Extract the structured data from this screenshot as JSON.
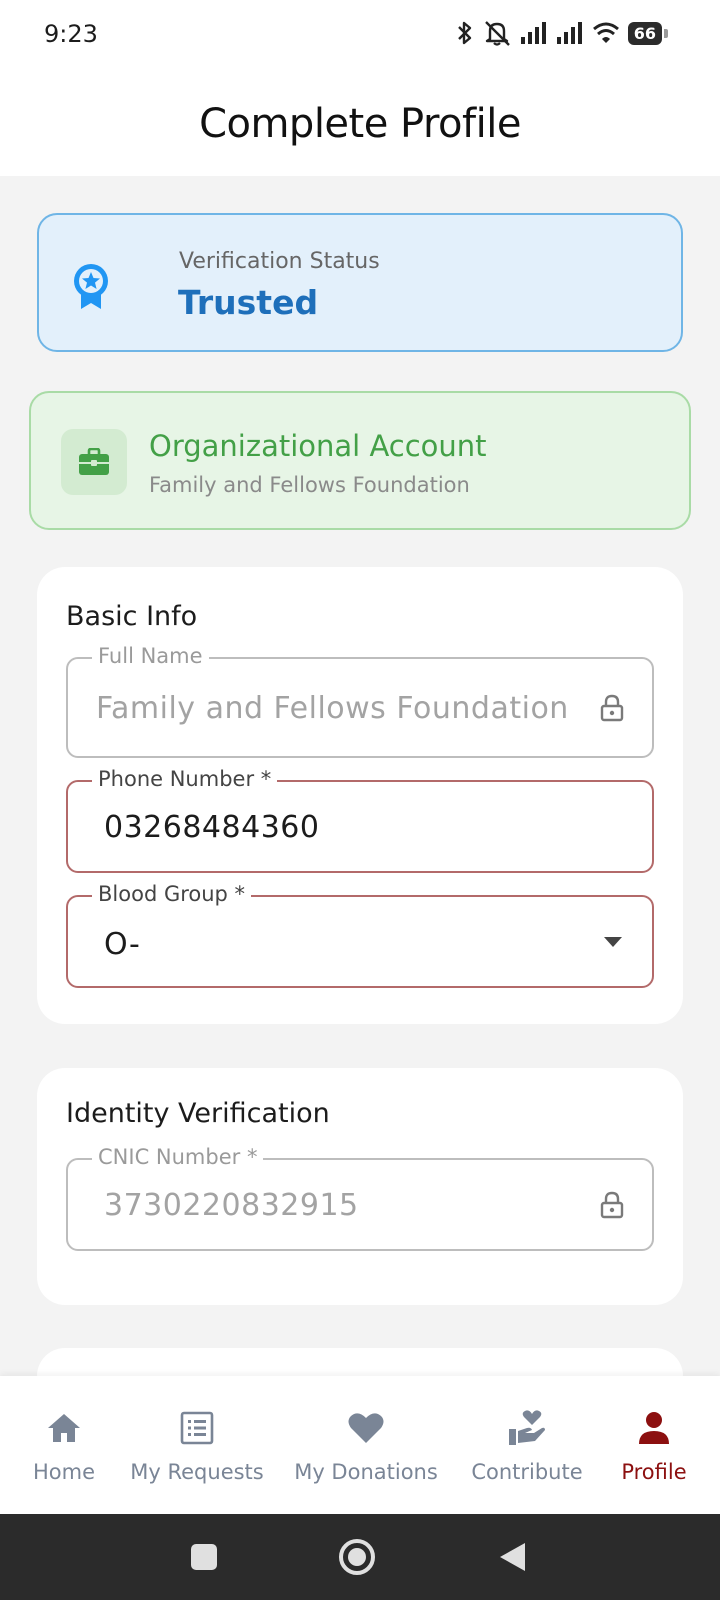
{
  "status_bar": {
    "time": "9:23",
    "battery": "66",
    "icons": [
      "bluetooth-icon",
      "mute-icon",
      "signal-icon",
      "signal-icon",
      "wifi-icon",
      "battery-icon"
    ]
  },
  "header": {
    "title": "Complete Profile"
  },
  "verification": {
    "label": "Verification Status",
    "value": "Trusted",
    "icon": "award-badge-icon",
    "color": "#1e6fba"
  },
  "organization": {
    "title": "Organizational Account",
    "name": "Family and Fellows Foundation",
    "icon": "briefcase-icon",
    "color": "#43a047"
  },
  "basic_info": {
    "title": "Basic Info",
    "full_name": {
      "label": "Full Name",
      "value": "Family and Fellows Foundation",
      "locked": true
    },
    "phone": {
      "label": "Phone Number *",
      "value": "03268484360"
    },
    "blood_group": {
      "label": "Blood Group *",
      "value": "O-"
    }
  },
  "identity": {
    "title": "Identity Verification",
    "cnic": {
      "label": "CNIC Number *",
      "value": "3730220832915",
      "locked": true
    }
  },
  "nav": {
    "items": [
      {
        "label": "Home",
        "icon": "home-icon"
      },
      {
        "label": "My Requests",
        "icon": "list-icon"
      },
      {
        "label": "My Donations",
        "icon": "heart-icon"
      },
      {
        "label": "Contribute",
        "icon": "hand-heart-icon"
      },
      {
        "label": "Profile",
        "icon": "person-icon",
        "active": true
      }
    ],
    "active_color": "#8c1010",
    "inactive_color": "#7a8596"
  }
}
